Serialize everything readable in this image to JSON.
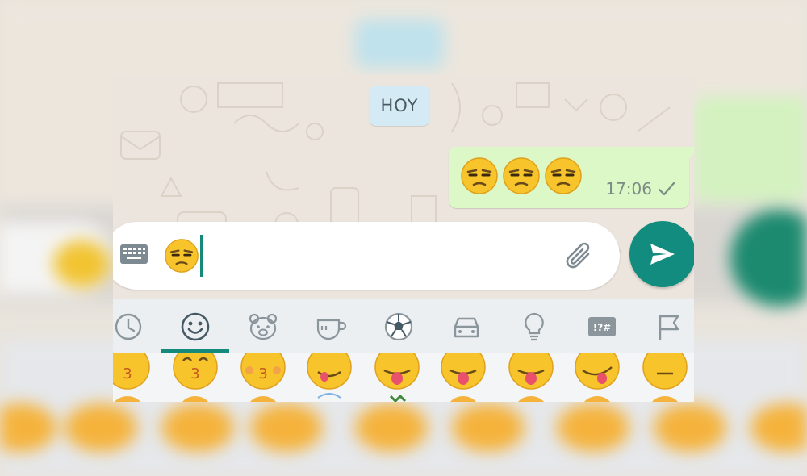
{
  "chat": {
    "date_label": "HOY",
    "message": {
      "emojis": [
        "unamused-face",
        "unamused-face",
        "unamused-face"
      ],
      "time": "17:06",
      "status": "sent-check"
    }
  },
  "composer": {
    "keyboard_toggle_icon": "keyboard-icon",
    "typed_emoji": "unamused-face",
    "attach_icon": "paperclip-icon",
    "send_icon": "send-icon"
  },
  "emoji_picker": {
    "tabs": [
      "recent",
      "smileys",
      "animals",
      "food",
      "activity",
      "travel",
      "objects",
      "symbols",
      "flags"
    ],
    "active_tab": "smileys",
    "symbols_tab_label": "!?#"
  },
  "colors": {
    "accent": "#128c7e",
    "outgoing_bubble": "#dcf8c6",
    "date_chip": "#d4eaf4",
    "chat_wallpaper": "#ece5dd"
  }
}
